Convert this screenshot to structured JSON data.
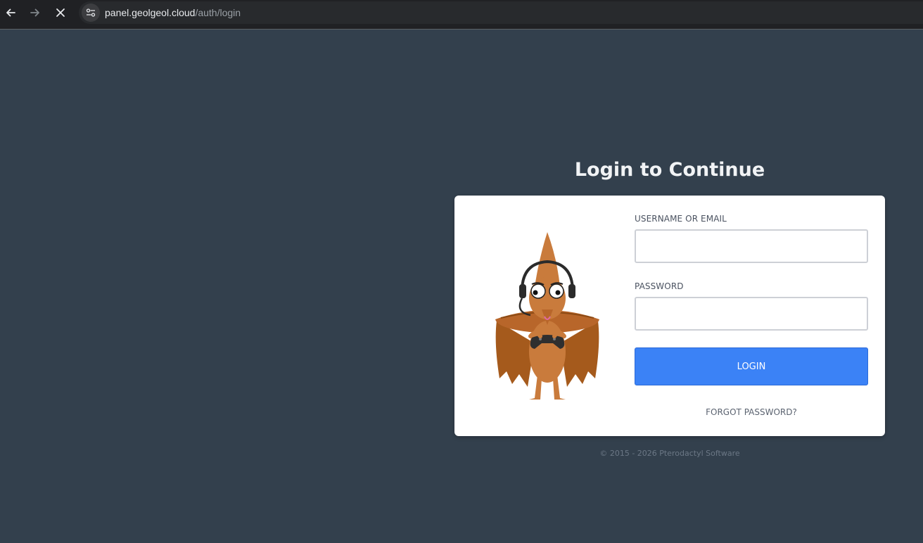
{
  "browser": {
    "url_host": "panel.geolgeol.cloud",
    "url_path": "/auth/login",
    "icons": [
      "back-arrow-icon",
      "forward-arrow-icon",
      "close-icon",
      "site-settings-icon"
    ]
  },
  "page": {
    "title": "Login to Continue",
    "form": {
      "username_label": "USERNAME OR EMAIL",
      "username_value": "",
      "password_label": "PASSWORD",
      "password_value": "",
      "login_button": "LOGIN",
      "forgot_link": "FORGOT PASSWORD?"
    },
    "footer": "© 2015 - 2026 Pterodactyl Software"
  },
  "colors": {
    "background": "#33404d",
    "card": "#ffffff",
    "accent_button": "#3b82f6",
    "browser_bar": "#202124"
  }
}
